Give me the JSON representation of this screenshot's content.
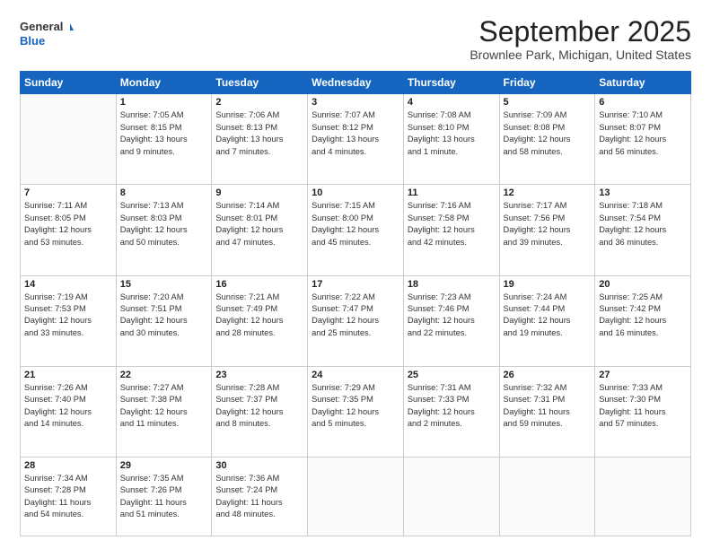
{
  "header": {
    "logo_line1": "General",
    "logo_line2": "Blue",
    "month": "September 2025",
    "location": "Brownlee Park, Michigan, United States"
  },
  "days_of_week": [
    "Sunday",
    "Monday",
    "Tuesday",
    "Wednesday",
    "Thursday",
    "Friday",
    "Saturday"
  ],
  "weeks": [
    [
      {
        "day": "",
        "info": ""
      },
      {
        "day": "1",
        "info": "Sunrise: 7:05 AM\nSunset: 8:15 PM\nDaylight: 13 hours\nand 9 minutes."
      },
      {
        "day": "2",
        "info": "Sunrise: 7:06 AM\nSunset: 8:13 PM\nDaylight: 13 hours\nand 7 minutes."
      },
      {
        "day": "3",
        "info": "Sunrise: 7:07 AM\nSunset: 8:12 PM\nDaylight: 13 hours\nand 4 minutes."
      },
      {
        "day": "4",
        "info": "Sunrise: 7:08 AM\nSunset: 8:10 PM\nDaylight: 13 hours\nand 1 minute."
      },
      {
        "day": "5",
        "info": "Sunrise: 7:09 AM\nSunset: 8:08 PM\nDaylight: 12 hours\nand 58 minutes."
      },
      {
        "day": "6",
        "info": "Sunrise: 7:10 AM\nSunset: 8:07 PM\nDaylight: 12 hours\nand 56 minutes."
      }
    ],
    [
      {
        "day": "7",
        "info": "Sunrise: 7:11 AM\nSunset: 8:05 PM\nDaylight: 12 hours\nand 53 minutes."
      },
      {
        "day": "8",
        "info": "Sunrise: 7:13 AM\nSunset: 8:03 PM\nDaylight: 12 hours\nand 50 minutes."
      },
      {
        "day": "9",
        "info": "Sunrise: 7:14 AM\nSunset: 8:01 PM\nDaylight: 12 hours\nand 47 minutes."
      },
      {
        "day": "10",
        "info": "Sunrise: 7:15 AM\nSunset: 8:00 PM\nDaylight: 12 hours\nand 45 minutes."
      },
      {
        "day": "11",
        "info": "Sunrise: 7:16 AM\nSunset: 7:58 PM\nDaylight: 12 hours\nand 42 minutes."
      },
      {
        "day": "12",
        "info": "Sunrise: 7:17 AM\nSunset: 7:56 PM\nDaylight: 12 hours\nand 39 minutes."
      },
      {
        "day": "13",
        "info": "Sunrise: 7:18 AM\nSunset: 7:54 PM\nDaylight: 12 hours\nand 36 minutes."
      }
    ],
    [
      {
        "day": "14",
        "info": "Sunrise: 7:19 AM\nSunset: 7:53 PM\nDaylight: 12 hours\nand 33 minutes."
      },
      {
        "day": "15",
        "info": "Sunrise: 7:20 AM\nSunset: 7:51 PM\nDaylight: 12 hours\nand 30 minutes."
      },
      {
        "day": "16",
        "info": "Sunrise: 7:21 AM\nSunset: 7:49 PM\nDaylight: 12 hours\nand 28 minutes."
      },
      {
        "day": "17",
        "info": "Sunrise: 7:22 AM\nSunset: 7:47 PM\nDaylight: 12 hours\nand 25 minutes."
      },
      {
        "day": "18",
        "info": "Sunrise: 7:23 AM\nSunset: 7:46 PM\nDaylight: 12 hours\nand 22 minutes."
      },
      {
        "day": "19",
        "info": "Sunrise: 7:24 AM\nSunset: 7:44 PM\nDaylight: 12 hours\nand 19 minutes."
      },
      {
        "day": "20",
        "info": "Sunrise: 7:25 AM\nSunset: 7:42 PM\nDaylight: 12 hours\nand 16 minutes."
      }
    ],
    [
      {
        "day": "21",
        "info": "Sunrise: 7:26 AM\nSunset: 7:40 PM\nDaylight: 12 hours\nand 14 minutes."
      },
      {
        "day": "22",
        "info": "Sunrise: 7:27 AM\nSunset: 7:38 PM\nDaylight: 12 hours\nand 11 minutes."
      },
      {
        "day": "23",
        "info": "Sunrise: 7:28 AM\nSunset: 7:37 PM\nDaylight: 12 hours\nand 8 minutes."
      },
      {
        "day": "24",
        "info": "Sunrise: 7:29 AM\nSunset: 7:35 PM\nDaylight: 12 hours\nand 5 minutes."
      },
      {
        "day": "25",
        "info": "Sunrise: 7:31 AM\nSunset: 7:33 PM\nDaylight: 12 hours\nand 2 minutes."
      },
      {
        "day": "26",
        "info": "Sunrise: 7:32 AM\nSunset: 7:31 PM\nDaylight: 11 hours\nand 59 minutes."
      },
      {
        "day": "27",
        "info": "Sunrise: 7:33 AM\nSunset: 7:30 PM\nDaylight: 11 hours\nand 57 minutes."
      }
    ],
    [
      {
        "day": "28",
        "info": "Sunrise: 7:34 AM\nSunset: 7:28 PM\nDaylight: 11 hours\nand 54 minutes."
      },
      {
        "day": "29",
        "info": "Sunrise: 7:35 AM\nSunset: 7:26 PM\nDaylight: 11 hours\nand 51 minutes."
      },
      {
        "day": "30",
        "info": "Sunrise: 7:36 AM\nSunset: 7:24 PM\nDaylight: 11 hours\nand 48 minutes."
      },
      {
        "day": "",
        "info": ""
      },
      {
        "day": "",
        "info": ""
      },
      {
        "day": "",
        "info": ""
      },
      {
        "day": "",
        "info": ""
      }
    ]
  ]
}
